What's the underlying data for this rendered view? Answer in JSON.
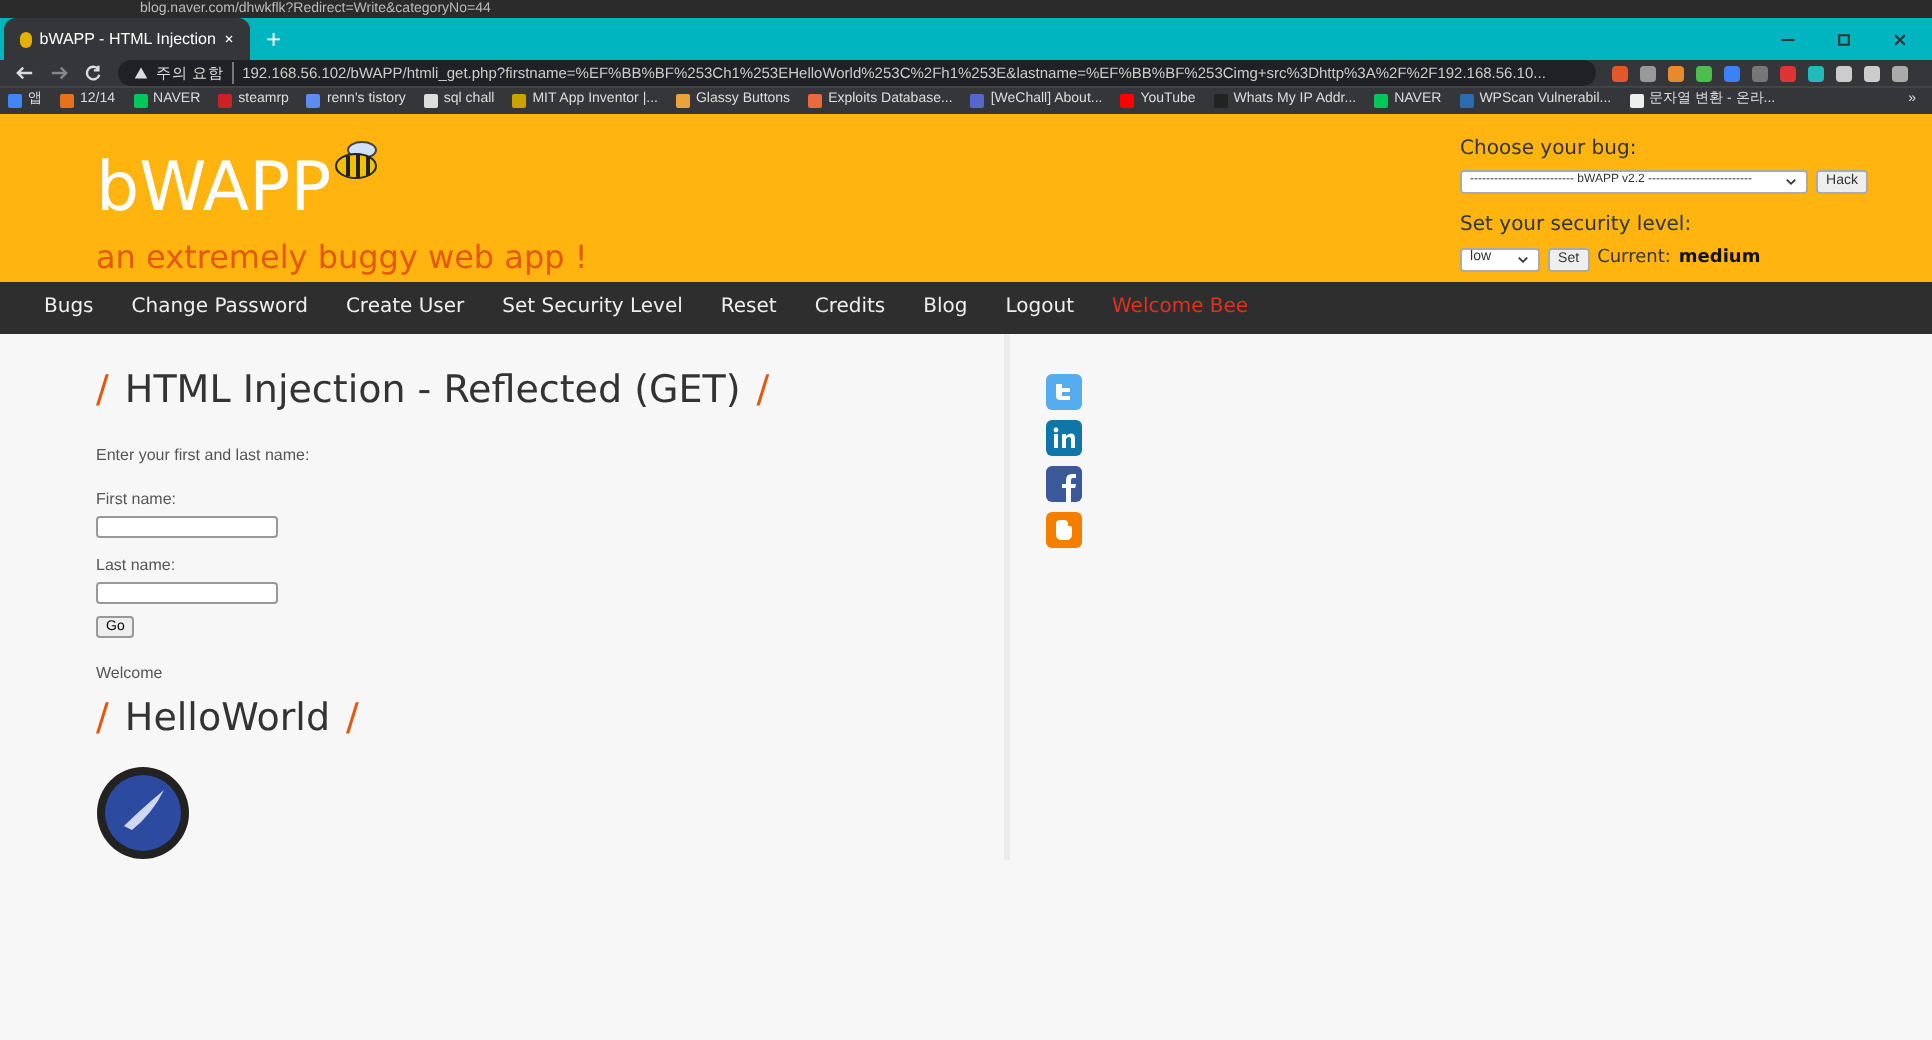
{
  "background_window": {
    "url": "blog.naver.com/dhwkflk?Redirect=Write&categoryNo=44"
  },
  "browser": {
    "tabs": [
      {
        "title": "bWAPP - HTML Injection",
        "selected": true
      }
    ],
    "new_tab": "+",
    "security_label": "주의 요함",
    "url": "192.168.56.102/bWAPP/htmli_get.php?firstname=%EF%BB%BF%253Ch1%253EHelloWorld%253C%2Fh1%253E&lastname=%EF%BB%BF%253Cimg+src%3Dhttp%3A%2F%2F192.168.56.10...",
    "bookmarks": [
      {
        "label": "앱",
        "color": "#4285f4"
      },
      {
        "label": "12/14",
        "color": "#e8711c"
      },
      {
        "label": "NAVER",
        "color": "#03c75a"
      },
      {
        "label": "steamrp",
        "color": "#cc2222"
      },
      {
        "label": "renn's tistory",
        "color": "#5b8def"
      },
      {
        "label": "sql chall",
        "color": "#dddddd"
      },
      {
        "label": "MIT App Inventor |...",
        "color": "#c9a400"
      },
      {
        "label": "Glassy Buttons",
        "color": "#e8a33d"
      },
      {
        "label": "Exploits Database...",
        "color": "#e86a3d"
      },
      {
        "label": "[WeChall] About...",
        "color": "#5566cc"
      },
      {
        "label": "YouTube",
        "color": "#ff0000"
      },
      {
        "label": "Whats My IP Addr...",
        "color": "#222222"
      },
      {
        "label": "NAVER",
        "color": "#03c75a"
      },
      {
        "label": "WPScan Vulnerabil...",
        "color": "#2b6cb0"
      },
      {
        "label": "문자열 변환 - 온라...",
        "color": "#eeeeee"
      }
    ],
    "more": "»"
  },
  "header": {
    "logo": "bWAPP",
    "tagline": "an extremely buggy web app !",
    "choose_label": "Choose your bug:",
    "bug_select": "-------------------------- bWAPP v2.2 --------------------------",
    "hack_button": "Hack",
    "security_label": "Set your security level:",
    "level_select": "low",
    "set_button": "Set",
    "current_label": "Current:",
    "current_value": "medium"
  },
  "nav": [
    {
      "label": "Bugs",
      "kind": "link"
    },
    {
      "label": "Change Password",
      "kind": "link"
    },
    {
      "label": "Create User",
      "kind": "link"
    },
    {
      "label": "Set Security Level",
      "kind": "link"
    },
    {
      "label": "Reset",
      "kind": "link"
    },
    {
      "label": "Credits",
      "kind": "link"
    },
    {
      "label": "Blog",
      "kind": "link"
    },
    {
      "label": "Logout",
      "kind": "link"
    },
    {
      "label": "Welcome Bee",
      "kind": "welcome"
    }
  ],
  "content": {
    "slash": "/",
    "title": "HTML Injection - Reflected (GET)",
    "instruction": "Enter your first and last name:",
    "first_label": "First name:",
    "last_label": "Last name:",
    "go_button": "Go",
    "welcome": "Welcome",
    "injected_heading": "HelloWorld"
  }
}
